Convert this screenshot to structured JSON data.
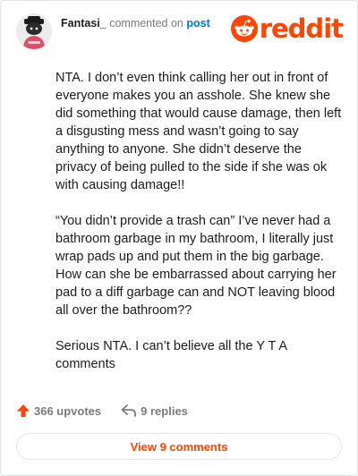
{
  "header": {
    "username": "Fantasi_",
    "commented_text": "commented on",
    "post_link": "post",
    "logo_text": "reddit"
  },
  "comment": {
    "paragraphs": [
      "NTA. I don’t even think calling her out in front of everyone makes you an asshole. She knew she did something that would cause damage, then left a disgusting mess and wasn’t going to say anything to anyone. She didn’t deserve the privacy of being pulled to the side if she was ok with causing damage!!",
      "“You didn’t provide a trash can” I’ve never had a bathroom garbage in my bathroom, I literally just wrap pads up and put them in the big garbage. How can she be embarrassed about carrying her pad to a diff garbage can and NOT leaving blood all over the bathroom??",
      "Serious NTA. I can’t believe all the Y T A comments"
    ]
  },
  "actions": {
    "upvotes": "366 upvotes",
    "replies": "9 replies"
  },
  "view_button": "View 9 comments",
  "colors": {
    "brand": "#ff4500",
    "link": "#0079d3",
    "muted": "#7c7c7c"
  },
  "icons": [
    "avatar",
    "reddit-logo-icon",
    "upvote-arrow-icon",
    "reply-arrow-icon"
  ]
}
